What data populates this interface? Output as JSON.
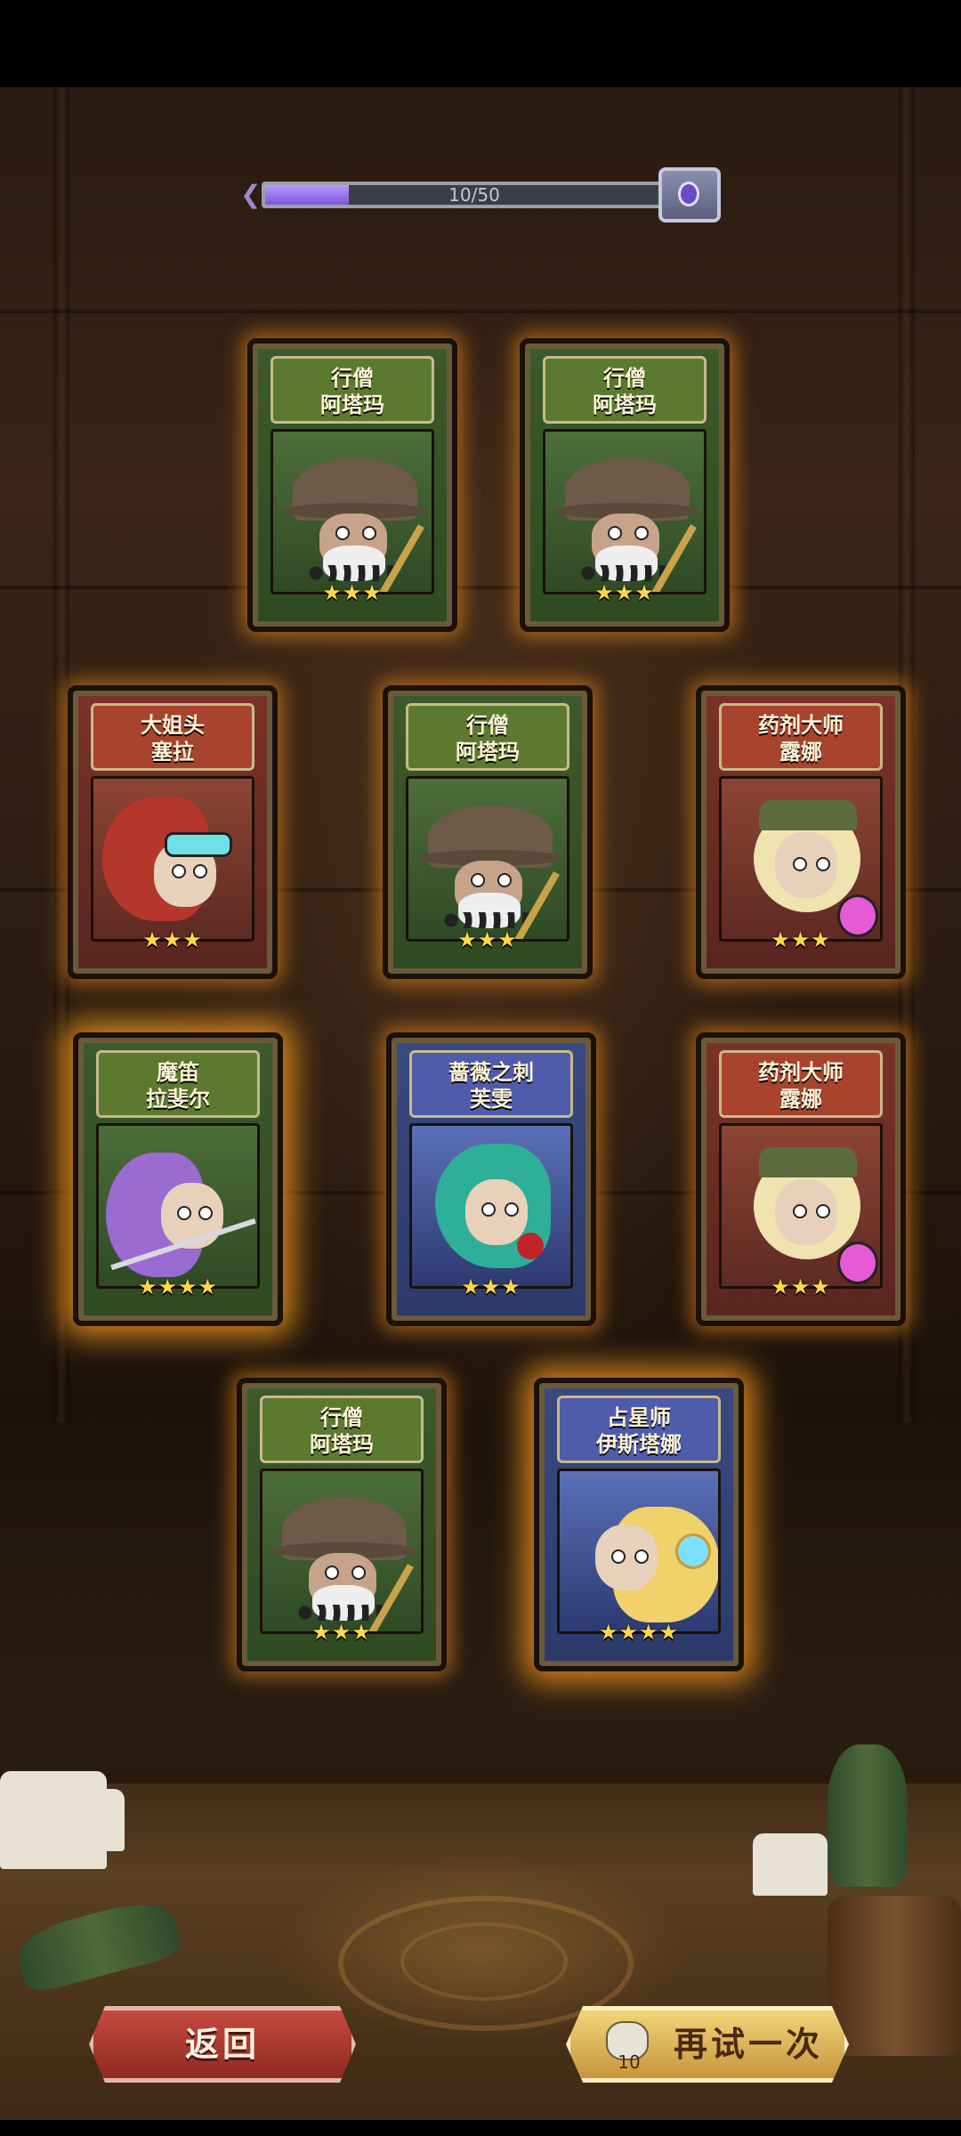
{
  "progress": {
    "text": "10/50",
    "current": 10,
    "max": 50
  },
  "cards": [
    {
      "name_line1": "行僧",
      "name_line2": "阿塔玛",
      "stars": "★★★",
      "rarity": 3,
      "theme": "green"
    },
    {
      "name_line1": "行僧",
      "name_line2": "阿塔玛",
      "stars": "★★★",
      "rarity": 3,
      "theme": "green"
    },
    {
      "name_line1": "大姐头",
      "name_line2": "塞拉",
      "stars": "★★★",
      "rarity": 3,
      "theme": "red"
    },
    {
      "name_line1": "行僧",
      "name_line2": "阿塔玛",
      "stars": "★★★",
      "rarity": 3,
      "theme": "green"
    },
    {
      "name_line1": "药剂大师",
      "name_line2": "露娜",
      "stars": "★★★",
      "rarity": 3,
      "theme": "red"
    },
    {
      "name_line1": "魔笛",
      "name_line2": "拉斐尔",
      "stars": "★★★★",
      "rarity": 4,
      "theme": "green"
    },
    {
      "name_line1": "蔷薇之刺",
      "name_line2": "芙雯",
      "stars": "★★★",
      "rarity": 3,
      "theme": "blue"
    },
    {
      "name_line1": "药剂大师",
      "name_line2": "露娜",
      "stars": "★★★",
      "rarity": 3,
      "theme": "red"
    },
    {
      "name_line1": "行僧",
      "name_line2": "阿塔玛",
      "stars": "★★★",
      "rarity": 3,
      "theme": "green"
    },
    {
      "name_line1": "占星师",
      "name_line2": "伊斯塔娜",
      "stars": "★★★★",
      "rarity": 4,
      "theme": "blue"
    }
  ],
  "buttons": {
    "back": "返回",
    "retry": "再试一次",
    "retry_cost": "10"
  }
}
